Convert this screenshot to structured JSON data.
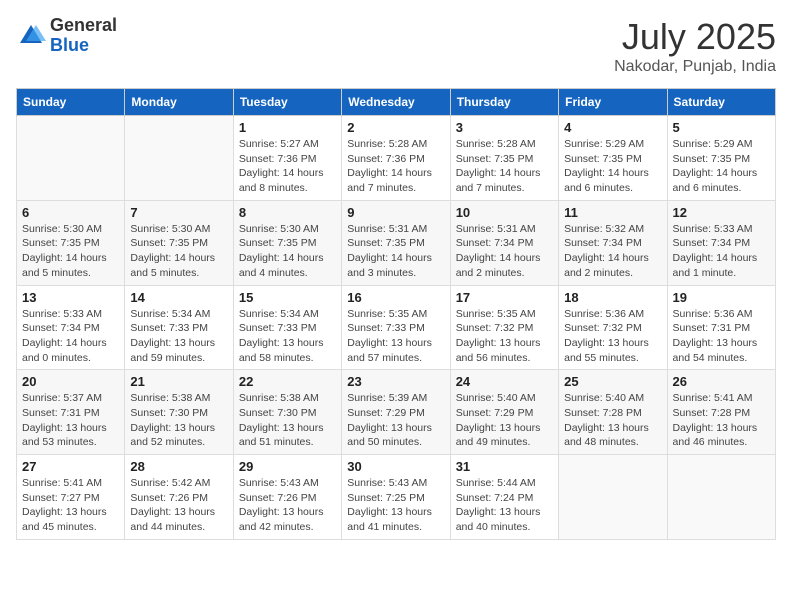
{
  "logo": {
    "general": "General",
    "blue": "Blue"
  },
  "title": "July 2025",
  "location": "Nakodar, Punjab, India",
  "weekdays": [
    "Sunday",
    "Monday",
    "Tuesday",
    "Wednesday",
    "Thursday",
    "Friday",
    "Saturday"
  ],
  "weeks": [
    [
      {
        "day": "",
        "info": ""
      },
      {
        "day": "",
        "info": ""
      },
      {
        "day": "1",
        "info": "Sunrise: 5:27 AM\nSunset: 7:36 PM\nDaylight: 14 hours and 8 minutes."
      },
      {
        "day": "2",
        "info": "Sunrise: 5:28 AM\nSunset: 7:36 PM\nDaylight: 14 hours and 7 minutes."
      },
      {
        "day": "3",
        "info": "Sunrise: 5:28 AM\nSunset: 7:35 PM\nDaylight: 14 hours and 7 minutes."
      },
      {
        "day": "4",
        "info": "Sunrise: 5:29 AM\nSunset: 7:35 PM\nDaylight: 14 hours and 6 minutes."
      },
      {
        "day": "5",
        "info": "Sunrise: 5:29 AM\nSunset: 7:35 PM\nDaylight: 14 hours and 6 minutes."
      }
    ],
    [
      {
        "day": "6",
        "info": "Sunrise: 5:30 AM\nSunset: 7:35 PM\nDaylight: 14 hours and 5 minutes."
      },
      {
        "day": "7",
        "info": "Sunrise: 5:30 AM\nSunset: 7:35 PM\nDaylight: 14 hours and 5 minutes."
      },
      {
        "day": "8",
        "info": "Sunrise: 5:30 AM\nSunset: 7:35 PM\nDaylight: 14 hours and 4 minutes."
      },
      {
        "day": "9",
        "info": "Sunrise: 5:31 AM\nSunset: 7:35 PM\nDaylight: 14 hours and 3 minutes."
      },
      {
        "day": "10",
        "info": "Sunrise: 5:31 AM\nSunset: 7:34 PM\nDaylight: 14 hours and 2 minutes."
      },
      {
        "day": "11",
        "info": "Sunrise: 5:32 AM\nSunset: 7:34 PM\nDaylight: 14 hours and 2 minutes."
      },
      {
        "day": "12",
        "info": "Sunrise: 5:33 AM\nSunset: 7:34 PM\nDaylight: 14 hours and 1 minute."
      }
    ],
    [
      {
        "day": "13",
        "info": "Sunrise: 5:33 AM\nSunset: 7:34 PM\nDaylight: 14 hours and 0 minutes."
      },
      {
        "day": "14",
        "info": "Sunrise: 5:34 AM\nSunset: 7:33 PM\nDaylight: 13 hours and 59 minutes."
      },
      {
        "day": "15",
        "info": "Sunrise: 5:34 AM\nSunset: 7:33 PM\nDaylight: 13 hours and 58 minutes."
      },
      {
        "day": "16",
        "info": "Sunrise: 5:35 AM\nSunset: 7:33 PM\nDaylight: 13 hours and 57 minutes."
      },
      {
        "day": "17",
        "info": "Sunrise: 5:35 AM\nSunset: 7:32 PM\nDaylight: 13 hours and 56 minutes."
      },
      {
        "day": "18",
        "info": "Sunrise: 5:36 AM\nSunset: 7:32 PM\nDaylight: 13 hours and 55 minutes."
      },
      {
        "day": "19",
        "info": "Sunrise: 5:36 AM\nSunset: 7:31 PM\nDaylight: 13 hours and 54 minutes."
      }
    ],
    [
      {
        "day": "20",
        "info": "Sunrise: 5:37 AM\nSunset: 7:31 PM\nDaylight: 13 hours and 53 minutes."
      },
      {
        "day": "21",
        "info": "Sunrise: 5:38 AM\nSunset: 7:30 PM\nDaylight: 13 hours and 52 minutes."
      },
      {
        "day": "22",
        "info": "Sunrise: 5:38 AM\nSunset: 7:30 PM\nDaylight: 13 hours and 51 minutes."
      },
      {
        "day": "23",
        "info": "Sunrise: 5:39 AM\nSunset: 7:29 PM\nDaylight: 13 hours and 50 minutes."
      },
      {
        "day": "24",
        "info": "Sunrise: 5:40 AM\nSunset: 7:29 PM\nDaylight: 13 hours and 49 minutes."
      },
      {
        "day": "25",
        "info": "Sunrise: 5:40 AM\nSunset: 7:28 PM\nDaylight: 13 hours and 48 minutes."
      },
      {
        "day": "26",
        "info": "Sunrise: 5:41 AM\nSunset: 7:28 PM\nDaylight: 13 hours and 46 minutes."
      }
    ],
    [
      {
        "day": "27",
        "info": "Sunrise: 5:41 AM\nSunset: 7:27 PM\nDaylight: 13 hours and 45 minutes."
      },
      {
        "day": "28",
        "info": "Sunrise: 5:42 AM\nSunset: 7:26 PM\nDaylight: 13 hours and 44 minutes."
      },
      {
        "day": "29",
        "info": "Sunrise: 5:43 AM\nSunset: 7:26 PM\nDaylight: 13 hours and 42 minutes."
      },
      {
        "day": "30",
        "info": "Sunrise: 5:43 AM\nSunset: 7:25 PM\nDaylight: 13 hours and 41 minutes."
      },
      {
        "day": "31",
        "info": "Sunrise: 5:44 AM\nSunset: 7:24 PM\nDaylight: 13 hours and 40 minutes."
      },
      {
        "day": "",
        "info": ""
      },
      {
        "day": "",
        "info": ""
      }
    ]
  ]
}
